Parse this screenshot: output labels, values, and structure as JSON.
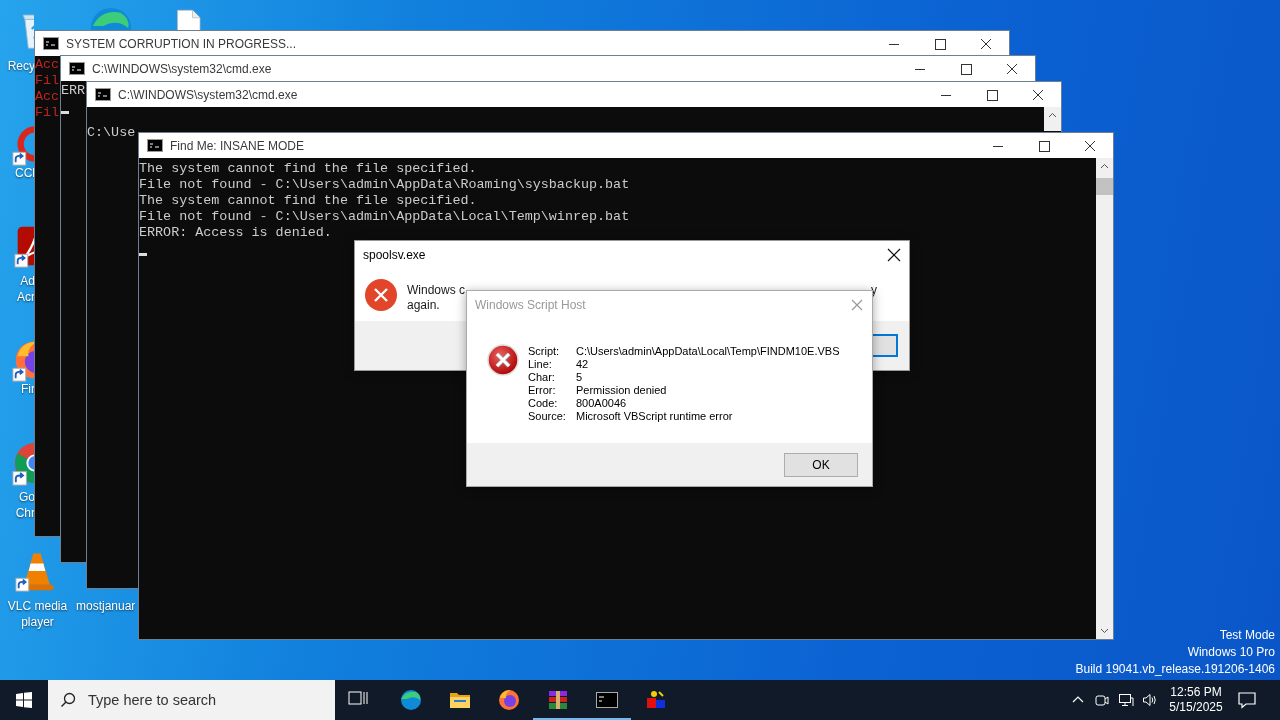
{
  "desktop_icons": [
    {
      "kind": "recycle-bin",
      "label": "Recy",
      "shortcut": false
    },
    {
      "kind": "edge"
    },
    {
      "kind": "file"
    },
    {
      "kind": "ccleaner",
      "label": "CCl",
      "shortcut": true
    },
    {
      "kind": "acrobat",
      "label": "Ad\nAcr",
      "shortcut": true
    },
    {
      "kind": "firefox",
      "label": "Fir",
      "shortcut": true
    },
    {
      "kind": "chrome",
      "label": "Go\nChr",
      "shortcut": true
    },
    {
      "kind": "vlc",
      "label": "VLC media\nplayer",
      "shortcut": true
    },
    {
      "label": "mostjanuar"
    }
  ],
  "windows": [
    {
      "kind": "console",
      "title": "SYSTEM CORRUPTION IN PROGRESS...",
      "error_text": true,
      "lines": [
        "Acc",
        "Fil",
        "Acc",
        "Fil"
      ],
      "cursor": false
    },
    {
      "kind": "console",
      "title": "C:\\WINDOWS\\system32\\cmd.exe",
      "error_text": false,
      "lines": [
        "ERR"
      ],
      "cursor": true
    },
    {
      "kind": "console",
      "title": "C:\\WINDOWS\\system32\\cmd.exe",
      "error_text": false,
      "lines": [
        "C:\\Use"
      ],
      "cursor": false
    },
    {
      "kind": "console",
      "title": "Find Me: INSANE MODE",
      "error_text": false,
      "lines": [
        "The system cannot find the file specified.",
        "File not found - C:\\Users\\admin\\AppData\\Roaming\\sysbackup.bat",
        "The system cannot find the file specified.",
        "File not found - C:\\Users\\admin\\AppData\\Local\\Temp\\winrep.bat",
        "ERROR: Access is denied."
      ],
      "cursor": true
    },
    {
      "kind": "message_box",
      "title": "spoolsv.exe",
      "active": true,
      "message": {
        "line_1_start": "Windows c",
        "line_1_end": "y",
        "line_2": "again."
      }
    },
    {
      "kind": "script_error",
      "title": "Windows Script Host",
      "active": false,
      "fields": [
        {
          "label": "Script:",
          "value": "C:\\Users\\admin\\AppData\\Local\\Temp\\FINDM10E.VBS"
        },
        {
          "label": "Line:",
          "value": "42"
        },
        {
          "label": "Char:",
          "value": "5"
        },
        {
          "label": "Error:",
          "value": "Permission denied"
        },
        {
          "label": "Code:",
          "value": "800A0046"
        },
        {
          "label": "Source:",
          "value": "Microsoft VBScript runtime error"
        }
      ],
      "button": "OK"
    }
  ],
  "desktop_info": [
    "Test Mode",
    "Windows 10 Pro",
    "Build 19041.vb_release.191206-1406"
  ],
  "taskbar": {
    "search": {
      "placeholder": "Type here to search"
    },
    "apps": [
      {
        "kind": "task-view",
        "running": false
      },
      {
        "kind": "edge",
        "running": false
      },
      {
        "kind": "explorer",
        "running": false
      },
      {
        "kind": "firefox",
        "running": false
      },
      {
        "kind": "winrar",
        "running": true
      },
      {
        "kind": "cmd",
        "running": true
      },
      {
        "kind": "app",
        "running": false
      }
    ],
    "clock": {
      "time": "12:56 PM",
      "date": "5/15/2025"
    }
  }
}
